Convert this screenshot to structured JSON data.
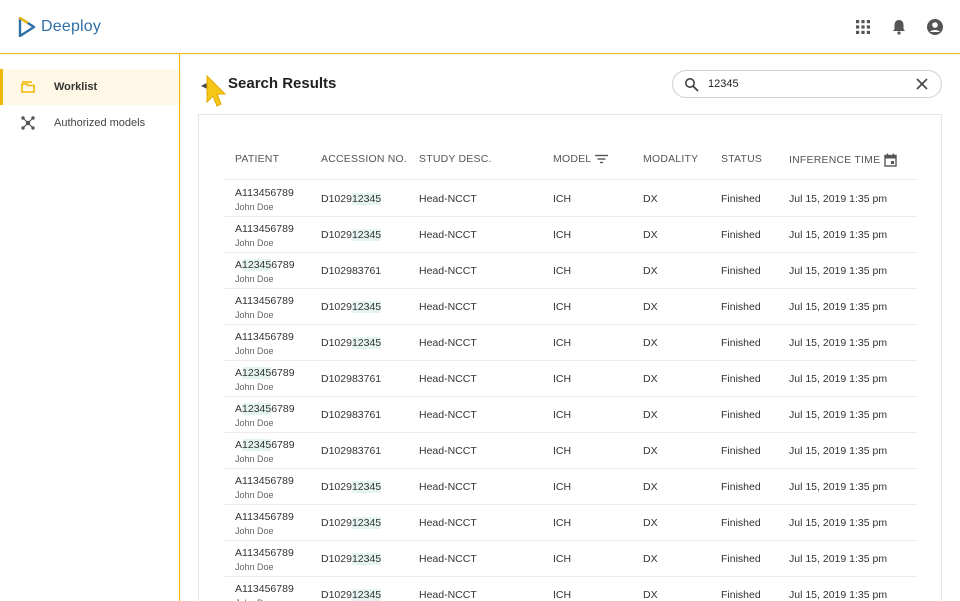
{
  "app": {
    "name": "Deeploy"
  },
  "sidebar": {
    "items": [
      {
        "label": "Worklist",
        "icon": "worklist-icon",
        "active": true
      },
      {
        "label": "Authorized models",
        "icon": "models-icon",
        "active": false
      }
    ]
  },
  "page": {
    "title": "Search Results"
  },
  "search": {
    "value": "12345",
    "placeholder": ""
  },
  "colors": {
    "accent": "#f2b705",
    "brand": "#2f6fa8",
    "highlight": "#e3f4f1"
  },
  "table": {
    "columns": [
      "PATIENT",
      "ACCESSION NO.",
      "STUDY DESC.",
      "MODEL",
      "MODALITY",
      "STATUS",
      "INFERENCE TIME"
    ],
    "rows": [
      {
        "patient_id": "A113456789",
        "patient_name": "John Doe",
        "accession": "D102912345",
        "study": "Head-NCCT",
        "model": "ICH",
        "modality": "DX",
        "status": "Finished",
        "time": "Jul 15, 2019 1:35 pm"
      },
      {
        "patient_id": "A113456789",
        "patient_name": "John Doe",
        "accession": "D102912345",
        "study": "Head-NCCT",
        "model": "ICH",
        "modality": "DX",
        "status": "Finished",
        "time": "Jul 15, 2019 1:35 pm"
      },
      {
        "patient_id": "A123456789",
        "patient_name": "John Doe",
        "accession": "D102983761",
        "study": "Head-NCCT",
        "model": "ICH",
        "modality": "DX",
        "status": "Finished",
        "time": "Jul 15, 2019 1:35 pm"
      },
      {
        "patient_id": "A113456789",
        "patient_name": "John Doe",
        "accession": "D102912345",
        "study": "Head-NCCT",
        "model": "ICH",
        "modality": "DX",
        "status": "Finished",
        "time": "Jul 15, 2019 1:35 pm"
      },
      {
        "patient_id": "A113456789",
        "patient_name": "John Doe",
        "accession": "D102912345",
        "study": "Head-NCCT",
        "model": "ICH",
        "modality": "DX",
        "status": "Finished",
        "time": "Jul 15, 2019 1:35 pm"
      },
      {
        "patient_id": "A123456789",
        "patient_name": "John Doe",
        "accession": "D102983761",
        "study": "Head-NCCT",
        "model": "ICH",
        "modality": "DX",
        "status": "Finished",
        "time": "Jul 15, 2019 1:35 pm"
      },
      {
        "patient_id": "A123456789",
        "patient_name": "John Doe",
        "accession": "D102983761",
        "study": "Head-NCCT",
        "model": "ICH",
        "modality": "DX",
        "status": "Finished",
        "time": "Jul 15, 2019 1:35 pm"
      },
      {
        "patient_id": "A123456789",
        "patient_name": "John Doe",
        "accession": "D102983761",
        "study": "Head-NCCT",
        "model": "ICH",
        "modality": "DX",
        "status": "Finished",
        "time": "Jul 15, 2019 1:35 pm"
      },
      {
        "patient_id": "A113456789",
        "patient_name": "John Doe",
        "accession": "D102912345",
        "study": "Head-NCCT",
        "model": "ICH",
        "modality": "DX",
        "status": "Finished",
        "time": "Jul 15, 2019 1:35 pm"
      },
      {
        "patient_id": "A113456789",
        "patient_name": "John Doe",
        "accession": "D102912345",
        "study": "Head-NCCT",
        "model": "ICH",
        "modality": "DX",
        "status": "Finished",
        "time": "Jul 15, 2019 1:35 pm"
      },
      {
        "patient_id": "A113456789",
        "patient_name": "John Doe",
        "accession": "D102912345",
        "study": "Head-NCCT",
        "model": "ICH",
        "modality": "DX",
        "status": "Finished",
        "time": "Jul 15, 2019 1:35 pm"
      },
      {
        "patient_id": "A113456789",
        "patient_name": "John Doe",
        "accession": "D102912345",
        "study": "Head-NCCT",
        "model": "ICH",
        "modality": "DX",
        "status": "Finished",
        "time": "Jul 15, 2019 1:35 pm"
      }
    ]
  }
}
